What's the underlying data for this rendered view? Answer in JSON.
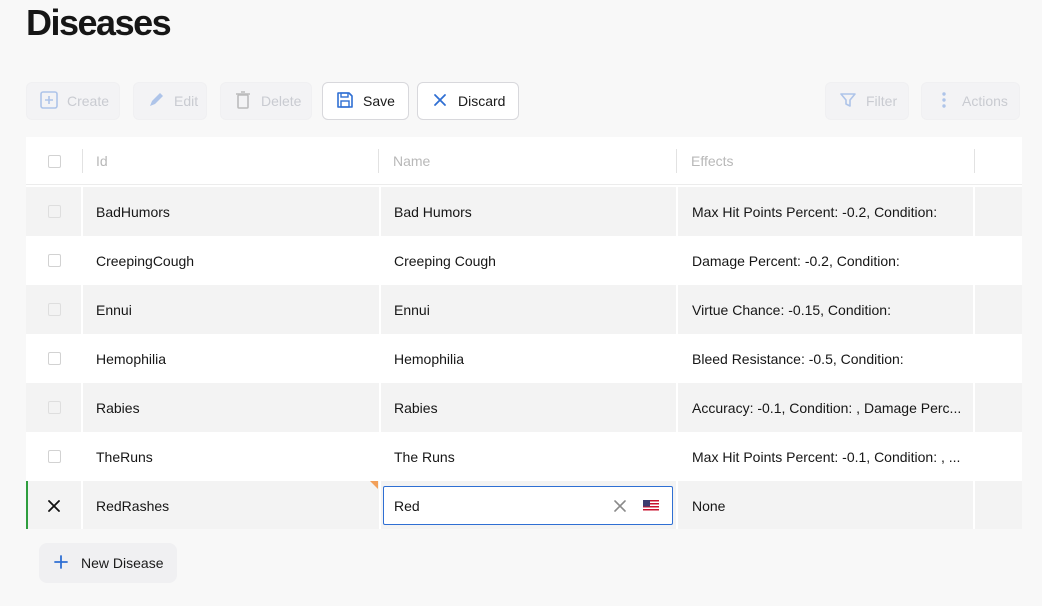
{
  "page": {
    "title": "Diseases"
  },
  "toolbar": {
    "create": "Create",
    "edit": "Edit",
    "delete": "Delete",
    "save": "Save",
    "discard": "Discard",
    "filter": "Filter",
    "actions": "Actions"
  },
  "grid": {
    "columns": {
      "id": "Id",
      "name": "Name",
      "effects": "Effects"
    },
    "rows": [
      {
        "id": "BadHumors",
        "name": "Bad Humors",
        "effects": "Max Hit Points Percent: -0.2, Condition:"
      },
      {
        "id": "CreepingCough",
        "name": "Creeping Cough",
        "effects": "Damage Percent: -0.2, Condition:"
      },
      {
        "id": "Ennui",
        "name": "Ennui",
        "effects": "Virtue Chance: -0.15, Condition:"
      },
      {
        "id": "Hemophilia",
        "name": "Hemophilia",
        "effects": "Bleed Resistance: -0.5, Condition:"
      },
      {
        "id": "Rabies",
        "name": "Rabies",
        "effects": "Accuracy: -0.1, Condition: , Damage Perc..."
      },
      {
        "id": "TheRuns",
        "name": "The Runs",
        "effects": "Max Hit Points Percent: -0.1, Condition: , ..."
      }
    ],
    "editing_row": {
      "id": "RedRashes",
      "name_value": "Red",
      "effects": "None"
    }
  },
  "new_button": {
    "label": "New Disease"
  },
  "colors": {
    "accent": "#2f6fd3",
    "edit_marker": "#2e9e3e",
    "modified_marker": "#f2a05a"
  },
  "icons": [
    "create-icon",
    "edit-icon",
    "delete-icon",
    "save-icon",
    "discard-icon",
    "filter-icon",
    "actions-icon",
    "cancel-edit-icon",
    "clear-icon",
    "flag-icon",
    "plus-icon"
  ]
}
